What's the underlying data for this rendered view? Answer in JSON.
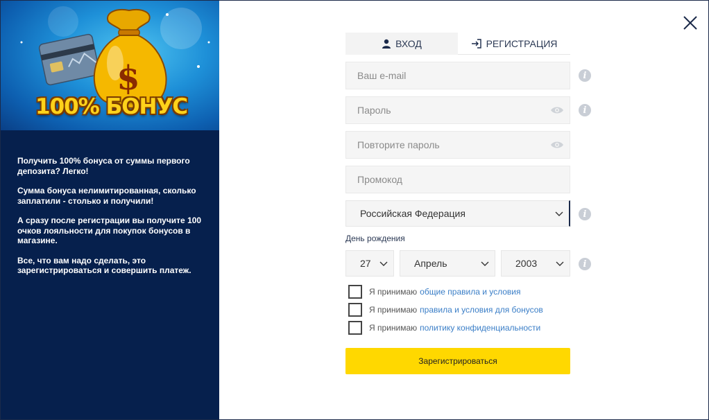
{
  "banner": {
    "title": "100% БОНУС",
    "bag_symbol": "$",
    "icons": [
      "money-bag-icon",
      "credit-card-icon"
    ]
  },
  "promo": {
    "paragraphs": [
      "Получить 100% бонуса от суммы первого депозита? Легко!",
      "Сумма бонуса нелимитированная, сколько заплатили - столько и получили!",
      "А сразу после регистрации вы получите 100 очков лояльности для покупок бонусов в магазине.",
      "Все, что вам надо сделать, это зарегистрироваться и совершить платеж."
    ]
  },
  "tabs": {
    "login": "ВХОД",
    "register": "РЕГИСТРАЦИЯ"
  },
  "form": {
    "email_placeholder": "Ваш e-mail",
    "password_placeholder": "Пароль",
    "password_repeat_placeholder": "Повторите пароль",
    "promo_placeholder": "Промокод",
    "country": "Российская Федерация",
    "dob_label": "День рождения",
    "dob_day": "27",
    "dob_month": "Апрель",
    "dob_year": "2003",
    "info_symbol": "i"
  },
  "checks": [
    {
      "prefix": "Я принимаю",
      "link": "общие правила и условия"
    },
    {
      "prefix": "Я принимаю",
      "link": "правила и условия для бонусов"
    },
    {
      "prefix": "Я принимаю",
      "link": "политику конфиденциальности"
    }
  ],
  "submit_label": "Зарегистрироваться",
  "colors": {
    "left_panel": "#06204d",
    "submit": "#ffd800",
    "link": "#3a7ec7",
    "bonus_text": "#ffd21a"
  }
}
